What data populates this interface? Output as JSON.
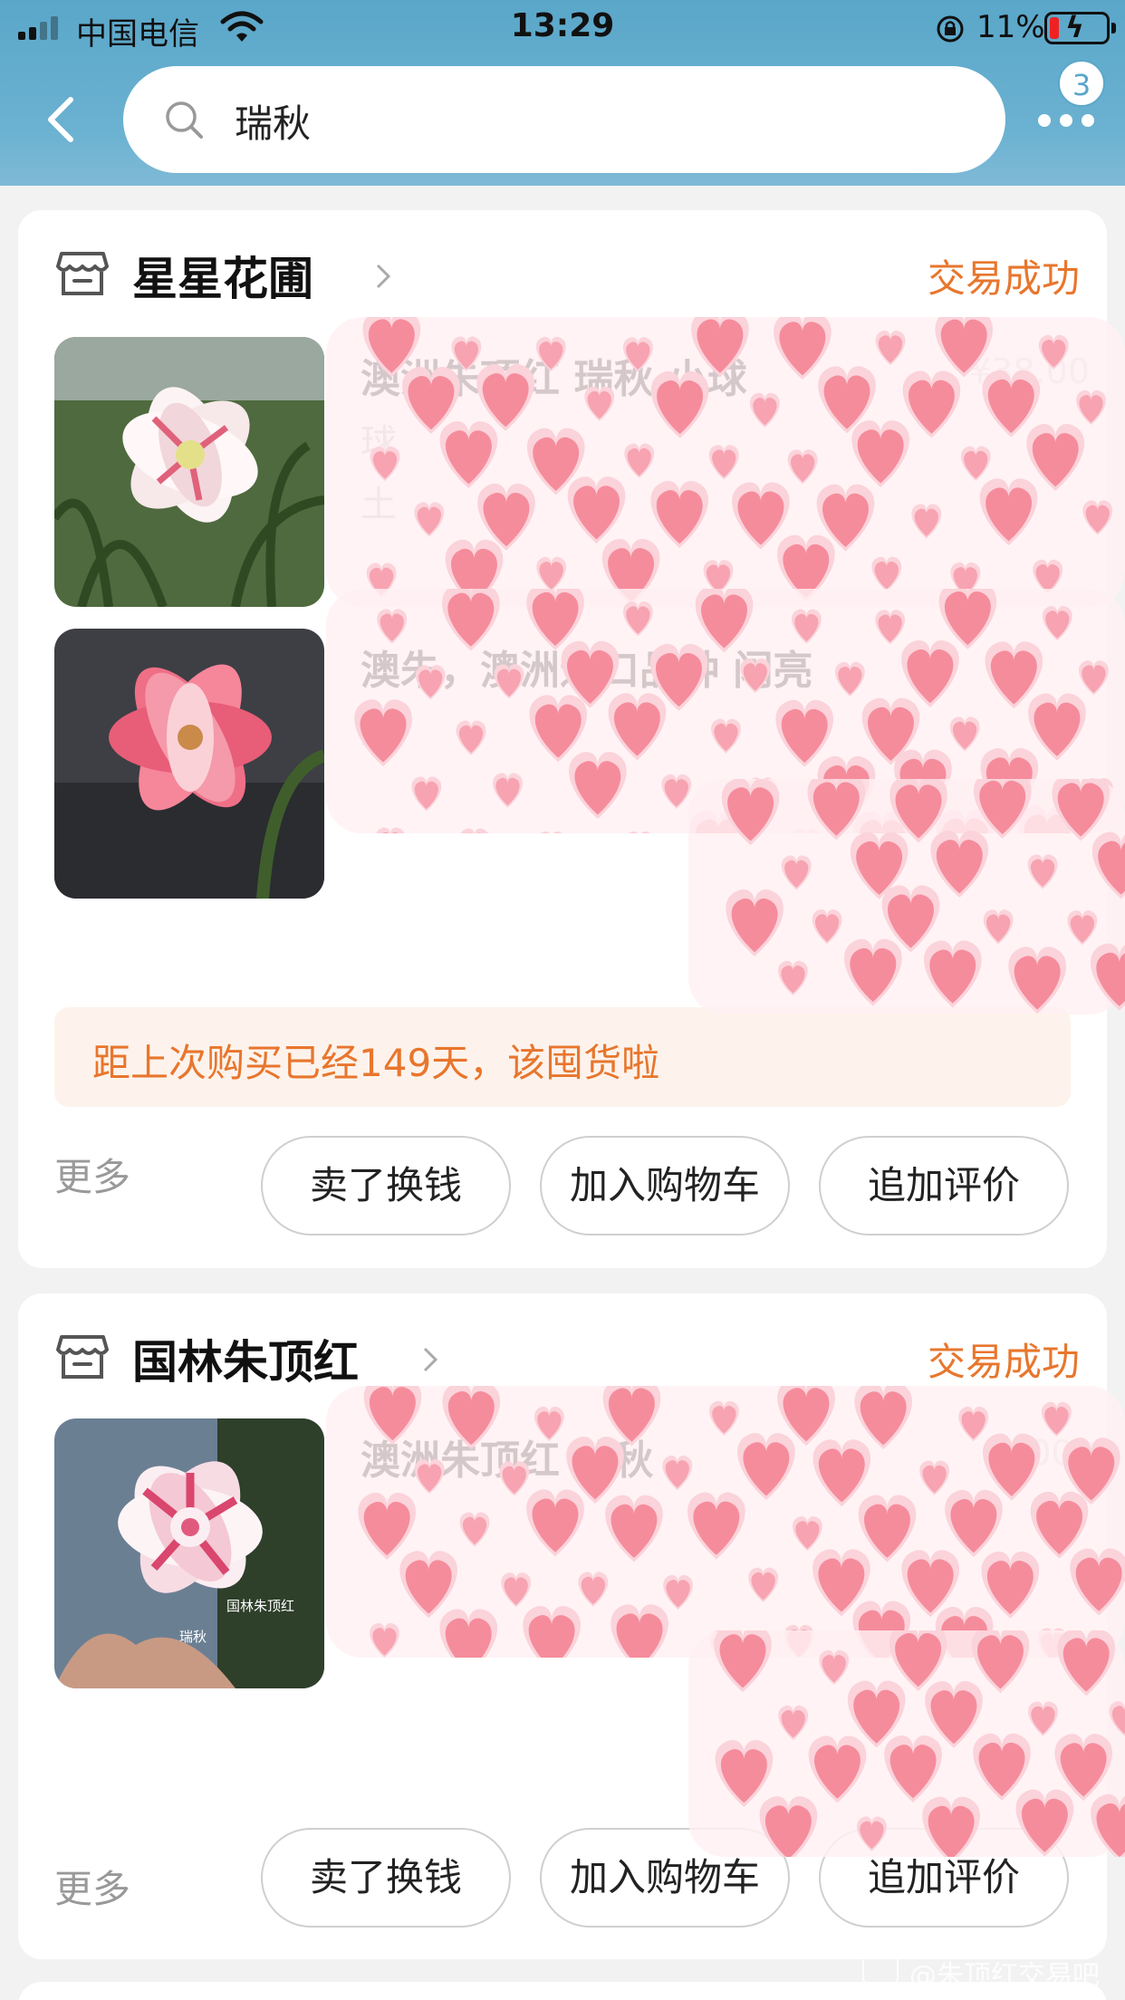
{
  "status_bar": {
    "carrier": "中国电信",
    "time": "13:29",
    "battery_percent": "11%",
    "battery_level": 0.11
  },
  "header": {
    "search_text": "瑞秋",
    "more_badge": "3"
  },
  "orders": [
    {
      "shop_name": "星星花圃",
      "status": "交易成功",
      "items": [
        {
          "title": "澳洲朱顶红  瑞秋  小球",
          "spec_line1": "球",
          "spec_line2": "土"
        },
        {
          "title": "澳朱，澳洲进口品种  闪亮",
          "spec_line1": "球",
          "spec_line2": ""
        }
      ],
      "repurchase_notice": "距上次购买已经149天，该囤货啦",
      "more_label": "更多",
      "buttons": [
        "卖了换钱",
        "加入购物车",
        "追加评价"
      ]
    },
    {
      "shop_name": "国林朱顶红",
      "status": "交易成功",
      "items": [
        {
          "title": "澳洲朱顶红  瑞秋",
          "photo_caption_1": "国林朱顶红",
          "photo_caption_2": "瑞秋"
        }
      ],
      "more_label": "更多",
      "buttons": [
        "卖了换钱",
        "加入购物车",
        "追加评价"
      ]
    }
  ],
  "watermark": "@朱顶红交易吧",
  "colors": {
    "header_bg": "#5aa7c9",
    "accent_orange": "#e8762d",
    "notice_bg": "#fdf3ec",
    "heart_pink": "#f58c9c"
  }
}
